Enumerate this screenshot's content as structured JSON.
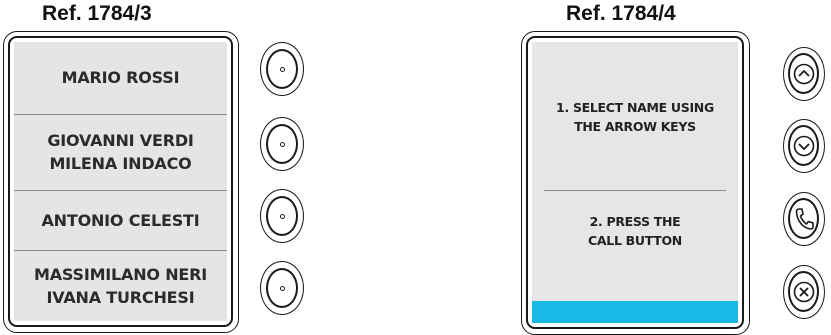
{
  "left_panel": {
    "ref": "Ref. 1784/3",
    "names": [
      "MARIO ROSSI",
      "GIOVANNI VERDI\nMILENA INDACO",
      "ANTONIO CELESTI",
      "MASSIMILANO NERI\nIVANA TURCHESI"
    ]
  },
  "right_panel": {
    "ref": "Ref. 1784/4",
    "instruction_1": "1. SELECT NAME USING\nTHE ARROW KEYS",
    "instruction_2": "2. PRESS THE\nCALL BUTTON",
    "accent_color": "#1ab8e4",
    "buttons": [
      "arrow-up-icon",
      "arrow-down-icon",
      "phone-icon",
      "close-icon"
    ]
  },
  "colors": {
    "screen_left": "#e3e5e6",
    "screen_right": "#e4e6e7",
    "outline": "#1a1a1a"
  }
}
